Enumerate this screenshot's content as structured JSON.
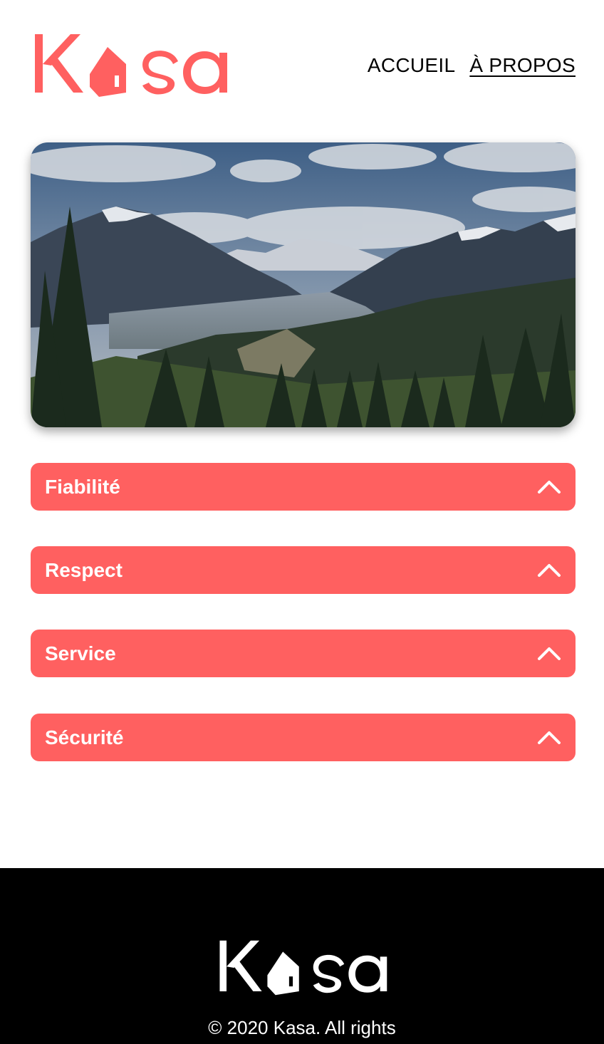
{
  "brand": {
    "name": "Kasa",
    "accent_color": "#FF6060"
  },
  "nav": {
    "items": [
      {
        "label": "ACCUEIL"
      },
      {
        "label": "À PROPOS"
      }
    ]
  },
  "sections": [
    {
      "title": "Fiabilité"
    },
    {
      "title": "Respect"
    },
    {
      "title": "Service"
    },
    {
      "title": "Sécurité"
    }
  ],
  "footer": {
    "copyright": "© 2020 Kasa. All rights"
  }
}
